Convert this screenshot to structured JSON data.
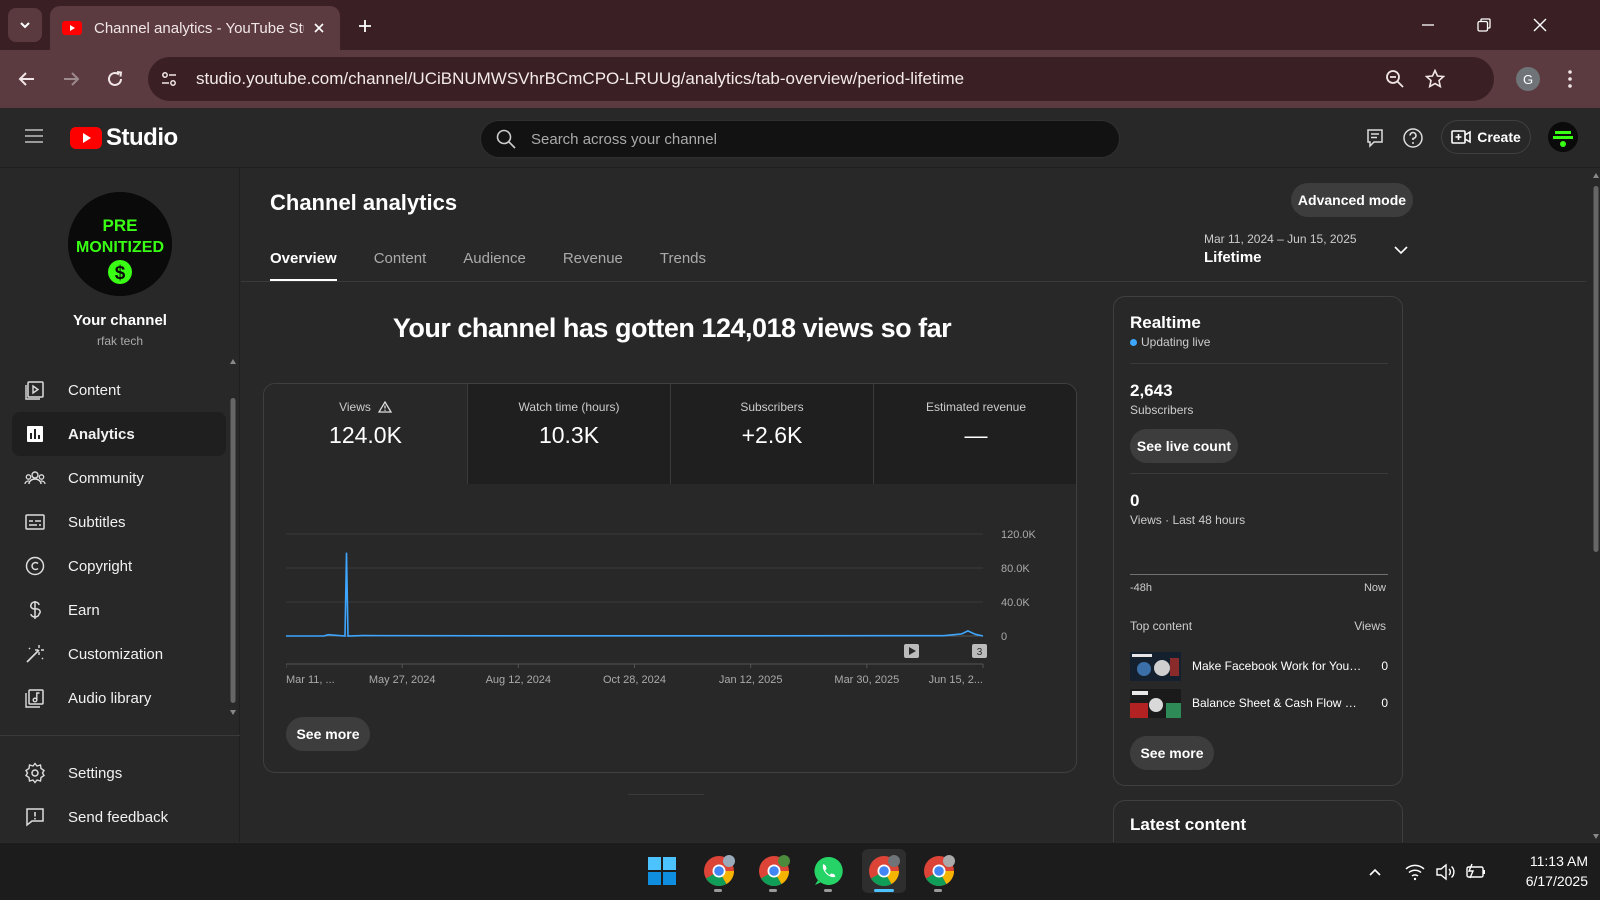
{
  "browser": {
    "tab_title": "Channel analytics - YouTube Studio",
    "url": "studio.youtube.com/channel/UCiBNUMWSVhrBCmCPO-LRUUg/analytics/tab-overview/period-lifetime",
    "profile_letter": "G"
  },
  "header": {
    "logo_text": "Studio",
    "search_placeholder": "Search across your channel",
    "create_label": "Create"
  },
  "sidebar": {
    "avatar_line1": "PRE",
    "avatar_line2": "MONITIZED",
    "channel_title": "Your channel",
    "channel_name": "rfak tech",
    "items": [
      {
        "label": "Content",
        "icon": "content-icon"
      },
      {
        "label": "Analytics",
        "icon": "analytics-icon",
        "active": true
      },
      {
        "label": "Community",
        "icon": "community-icon"
      },
      {
        "label": "Subtitles",
        "icon": "subtitles-icon"
      },
      {
        "label": "Copyright",
        "icon": "copyright-icon"
      },
      {
        "label": "Earn",
        "icon": "earn-icon"
      },
      {
        "label": "Customization",
        "icon": "customization-icon"
      },
      {
        "label": "Audio library",
        "icon": "audio-library-icon"
      }
    ],
    "bottom_items": [
      {
        "label": "Settings",
        "icon": "settings-icon"
      },
      {
        "label": "Send feedback",
        "icon": "feedback-icon"
      }
    ]
  },
  "main": {
    "title": "Channel analytics",
    "advanced_mode_label": "Advanced mode",
    "tabs": [
      "Overview",
      "Content",
      "Audience",
      "Revenue",
      "Trends"
    ],
    "active_tab": "Overview",
    "date_range": "Mar 11, 2024 – Jun 15, 2025",
    "period": "Lifetime",
    "headline": "Your channel has gotten 124,018 views so far",
    "metrics": [
      {
        "label": "Views",
        "value": "124.0K",
        "warning": true
      },
      {
        "label": "Watch time (hours)",
        "value": "10.3K"
      },
      {
        "label": "Subscribers",
        "value": "+2.6K"
      },
      {
        "label": "Estimated revenue",
        "value": "—"
      }
    ],
    "see_more_label": "See more"
  },
  "chart_data": {
    "type": "line",
    "x_tick_labels": [
      "Mar 11, ...",
      "May 27, 2024",
      "Aug 12, 2024",
      "Oct 28, 2024",
      "Jan 12, 2025",
      "Mar 30, 2025",
      "Jun 15, 2..."
    ],
    "y_tick_labels": [
      "120.0K",
      "80.0K",
      "40.0K",
      "0"
    ],
    "ylim": [
      0,
      120000
    ],
    "series": [
      {
        "x": [
          "2024-03-11",
          "2024-04-05",
          "2024-04-08",
          "2024-04-19",
          "2024-04-20",
          "2024-04-21",
          "2024-05-01",
          "2024-08-01",
          "2024-12-01",
          "2025-05-20",
          "2025-06-01",
          "2025-06-05",
          "2025-06-10",
          "2025-06-15"
        ],
        "values": [
          0,
          0,
          1500,
          0,
          98000,
          0,
          500,
          200,
          200,
          400,
          2500,
          6000,
          2000,
          0
        ]
      }
    ],
    "marker_count_label": "3",
    "grid": true
  },
  "realtime": {
    "title": "Realtime",
    "status": "Updating live",
    "subscribers_value": "2,643",
    "subscribers_label": "Subscribers",
    "live_count_label": "See live count",
    "views_value": "0",
    "views_label": "Views · Last 48 hours",
    "axis_start": "-48h",
    "axis_end": "Now",
    "top_content_label": "Top content",
    "top_views_label": "Views",
    "top_content": [
      {
        "title": "Make Facebook Work for You:...",
        "views": "0"
      },
      {
        "title": "Balance Sheet & Cash Flow H...",
        "views": "0"
      }
    ],
    "see_more_label": "See more"
  },
  "latest": {
    "title": "Latest content"
  },
  "taskbar": {
    "time": "11:13 AM",
    "date": "6/17/2025"
  },
  "colors": {
    "accent_blue": "#3ea6ff",
    "youtube_red": "#ff0000",
    "avatar_green": "#39ff14"
  }
}
